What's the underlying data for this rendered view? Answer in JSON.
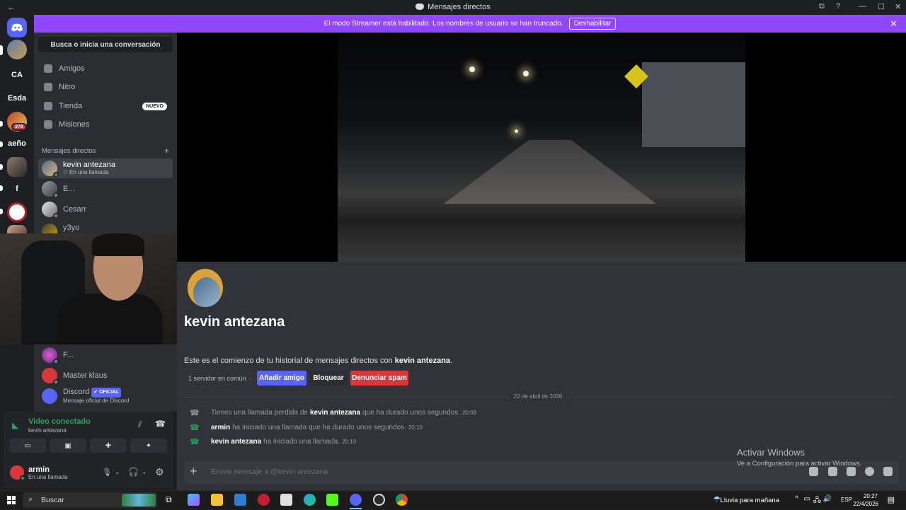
{
  "window": {
    "title": "Mensajes directos",
    "back": "←",
    "controls": [
      "⧉",
      "?",
      "—",
      "☐",
      "✕"
    ]
  },
  "banner": {
    "text": "El modo Streamer está habilitado. Los nombres de usuario se han truncado.",
    "button": "Deshabilitar",
    "close": "✕"
  },
  "servers": [
    {
      "label": "",
      "kind": "discord-home"
    },
    {
      "label": "",
      "kind": "avatar"
    },
    {
      "label": "CA"
    },
    {
      "label": "Esda"
    },
    {
      "label": "",
      "kind": "avatar",
      "badge": "378"
    },
    {
      "label": "aeño"
    },
    {
      "label": "",
      "kind": "avatar"
    },
    {
      "label": "f"
    },
    {
      "label": "",
      "kind": "avatar"
    },
    {
      "label": "",
      "kind": "avatar"
    }
  ],
  "sidebar": {
    "search": "Busca o inicia una conversación",
    "nav": [
      {
        "label": "Amigos",
        "icon": "friends-icon"
      },
      {
        "label": "Nitro",
        "icon": "nitro-icon"
      },
      {
        "label": "Tienda",
        "icon": "shop-icon",
        "badge": "NUEVO"
      },
      {
        "label": "Misiones",
        "icon": "quests-icon"
      }
    ],
    "dm_header": "Mensajes directos",
    "dm_add": "+",
    "dms": [
      {
        "name": "kevin antezana",
        "status": "En una llamada",
        "active": true
      },
      {
        "name": "E...",
        "status": ""
      },
      {
        "name": "Cesarr",
        "status": ""
      },
      {
        "name": "y3yo",
        "status": ""
      }
    ],
    "dms_lower": [
      {
        "name": "F...",
        "status": ""
      },
      {
        "name": "Master klaus",
        "status": ""
      },
      {
        "name": "Discord",
        "tag": "✔ OFICIAL",
        "status": "Mensaje oficial de Discord"
      }
    ]
  },
  "voice": {
    "title": "Video conectado",
    "subtitle": "kevin antezana"
  },
  "user": {
    "name": "armin",
    "status": "En una llamada"
  },
  "chat": {
    "name": "kevin antezana",
    "intro_prefix": "Este es el comienzo de tu historial de mensajes directos con ",
    "intro_name": "kevin antezana",
    "intro_suffix": ".",
    "mutual": "1 servidor en común",
    "buttons": {
      "add": "Añadir amigo",
      "block": "Bloquear",
      "spam": "Denunciar spam"
    },
    "date": "22 de abril de 2026",
    "messages": [
      {
        "type": "missed",
        "pre": "Tienes una llamada perdida de ",
        "who": "kevin antezana",
        "post": " que ha durado unos segundos.",
        "time": "20:08"
      },
      {
        "type": "call",
        "pre": "",
        "who": "armin",
        "post": " ha iniciado una llamada que ha durado unos segundos.",
        "time": "20:10"
      },
      {
        "type": "call",
        "pre": "",
        "who": "kevin antezana",
        "post": " ha iniciado una llamada.",
        "time": "20:10"
      }
    ],
    "input_placeholder": "Enviar mensaje a @kevin antezana"
  },
  "watermark": {
    "title": "Activar Windows",
    "subtitle": "Ve a Configuración para activar Windows."
  },
  "taskbar": {
    "search": "Buscar",
    "weather": "Lluvia para mañana",
    "lang": "ESP",
    "time": "20:27",
    "date": "22/4/2026"
  },
  "colors": {
    "accent": "#5865f2",
    "banner": "#9146ff",
    "danger": "#da373c",
    "online": "#23a55a"
  }
}
